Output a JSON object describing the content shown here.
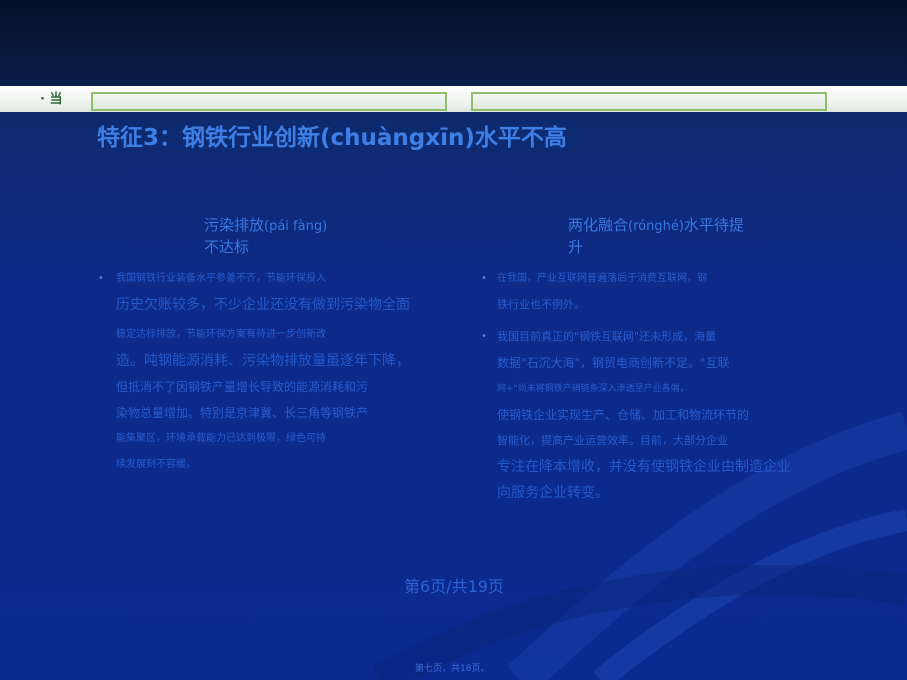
{
  "title": "特征3：钢铁行业创新(chuàngxīn)水平不高",
  "band_mark": "· 当",
  "left_column": {
    "heading_a": "污染排放",
    "heading_pinyin": "(pái fàng)",
    "heading_b": "不达标",
    "lines": [
      "我国钢铁行业装备水平参差不齐，节能环保投入",
      "历史欠账较多，不少企业还没有做到污染物全面",
      "稳定达标排放，节能环保方案有待进一步创新改",
      "造。吨钢能源消耗、污染物排放量虽逐年下降，",
      "但抵消不了因钢铁产量增长导致的能源消耗和污",
      "染物总量增加。特别是京津冀、长三角等钢铁产",
      "能集聚区，环境承载能力已达到极限，绿色可持",
      "续发展刻不容缓。"
    ]
  },
  "right_column": {
    "heading_a": "两化融合",
    "heading_pinyin": "(rónghé)",
    "heading_b": "水平待提",
    "heading_c": "升",
    "lines": [
      "在我国，产业互联网普遍落后于消费互联网，钢",
      "铁行业也不例外。",
      "我国目前真正的\"钢铁互联网\"还未形成，海量",
      "数据\"石沉大海\"，钢贸电商创新不足。\"互联",
      "网+\"尚未将钢铁产销链条深入渗透至产业各端，",
      "使钢铁企业实现生产、仓储、加工和物流环节的",
      "智能化，提高产业运营效率。目前，大部分企业",
      "专注在降本增收，并没有使钢铁企业由制造企业",
      "向服务企业转变。"
    ]
  },
  "page_number": "第6页/共19页",
  "footer": "第七页，共18页。"
}
